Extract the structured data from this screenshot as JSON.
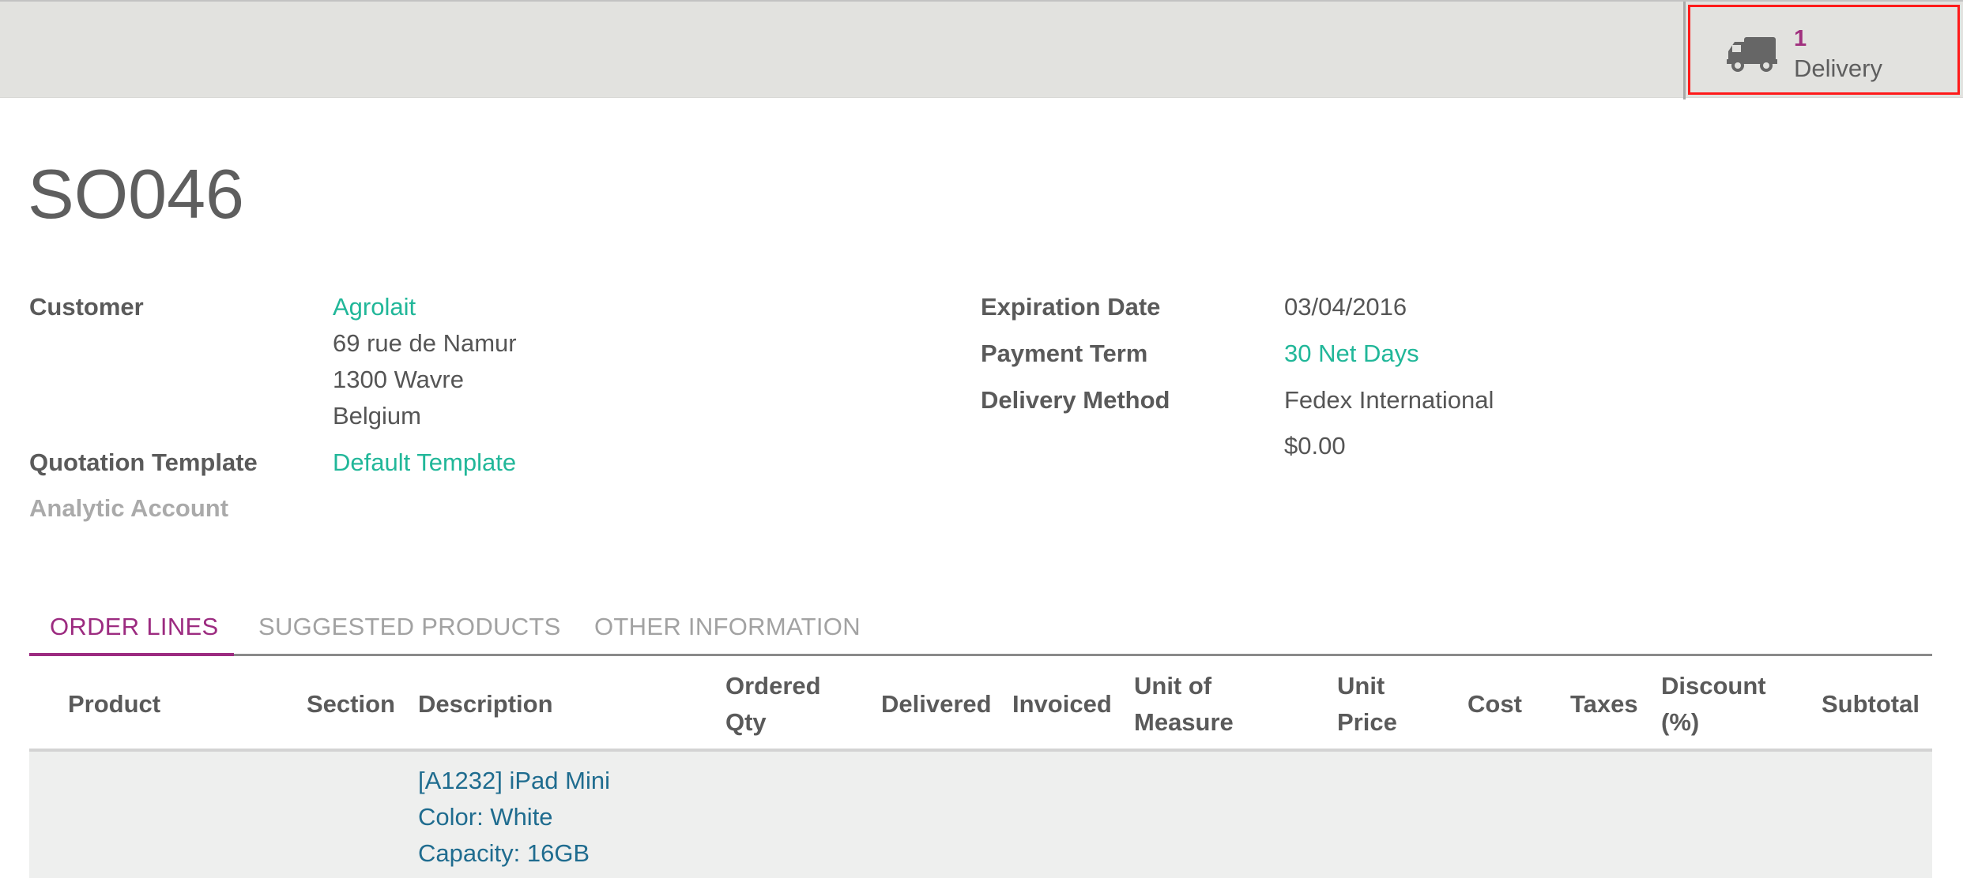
{
  "header": {
    "smart_buttons": [
      {
        "icon": "truck-icon",
        "count": "1",
        "label": "Delivery"
      }
    ]
  },
  "record": {
    "title": "SO046"
  },
  "form": {
    "left": {
      "customer": {
        "label": "Customer",
        "name": "Agrolait",
        "address_lines": [
          "69 rue de Namur",
          "1300 Wavre",
          "Belgium"
        ]
      },
      "quotation_template": {
        "label": "Quotation Template",
        "value": "Default Template"
      },
      "analytic_account": {
        "label": "Analytic Account",
        "value": ""
      }
    },
    "right": {
      "expiration_date": {
        "label": "Expiration Date",
        "value": "03/04/2016"
      },
      "payment_term": {
        "label": "Payment Term",
        "value": "30 Net Days"
      },
      "delivery_method": {
        "label": "Delivery Method",
        "value": "Fedex International",
        "price": "$0.00"
      }
    }
  },
  "tabs": [
    {
      "label": "ORDER LINES",
      "active": true
    },
    {
      "label": "SUGGESTED PRODUCTS",
      "active": false
    },
    {
      "label": "OTHER INFORMATION",
      "active": false
    }
  ],
  "order_lines": {
    "columns": [
      {
        "key": "product",
        "lines": [
          "Product"
        ]
      },
      {
        "key": "section",
        "lines": [
          "Section"
        ]
      },
      {
        "key": "description",
        "lines": [
          "Description"
        ]
      },
      {
        "key": "ordered_qty",
        "lines": [
          "Ordered",
          "Qty"
        ]
      },
      {
        "key": "delivered",
        "lines": [
          "Delivered"
        ]
      },
      {
        "key": "invoiced",
        "lines": [
          "Invoiced"
        ]
      },
      {
        "key": "uom",
        "lines": [
          "Unit of",
          "Measure"
        ]
      },
      {
        "key": "unit_price",
        "lines": [
          "Unit",
          "Price"
        ]
      },
      {
        "key": "cost",
        "lines": [
          "Cost"
        ]
      },
      {
        "key": "taxes",
        "lines": [
          "Taxes"
        ]
      },
      {
        "key": "discount",
        "lines": [
          "Discount",
          "(%)"
        ]
      },
      {
        "key": "subtotal",
        "lines": [
          "Subtotal"
        ]
      }
    ],
    "rows": [
      {
        "product": "",
        "section": "",
        "description_lines": [
          "[A1232] iPad Mini",
          "Color: White",
          "Capacity: 16GB"
        ]
      }
    ]
  },
  "colors": {
    "accent": "#9c2b80",
    "link": "#21b799",
    "description_link": "#1f6c8f",
    "highlight_border": "#ff1a1a",
    "header_bg": "#e2e2df"
  }
}
